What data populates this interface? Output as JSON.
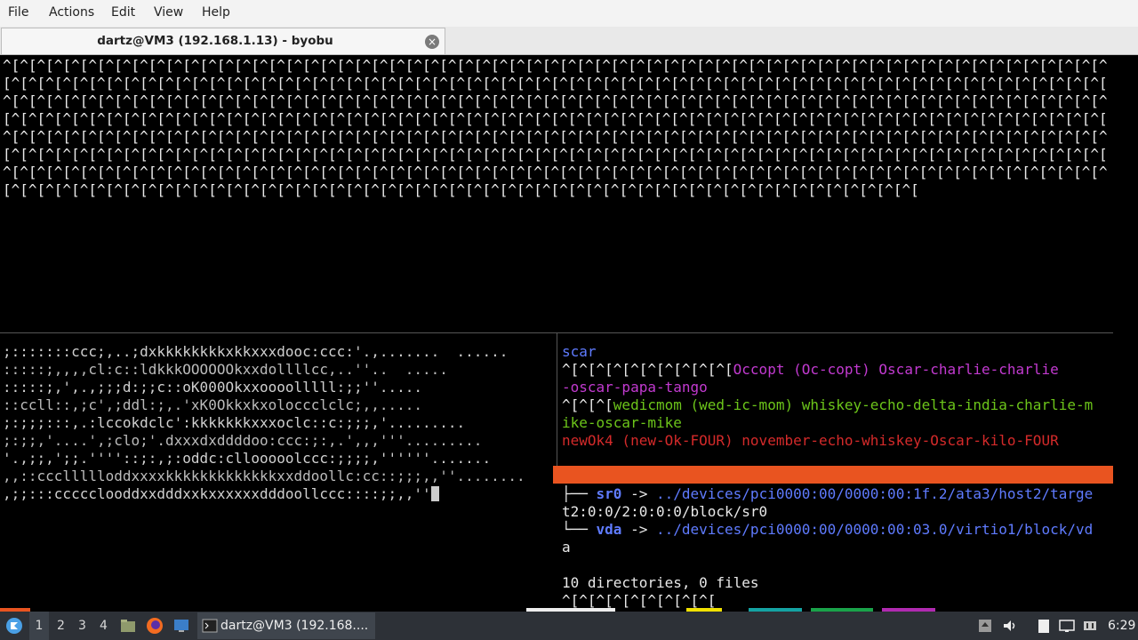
{
  "menu": {
    "file": "File",
    "actions": "Actions",
    "edit": "Edit",
    "view": "View",
    "help": "Help"
  },
  "tab": {
    "title": "dartz@VM3 (192.168.1.13) - byobu",
    "close": "×"
  },
  "terminal": {
    "top_lines": [
      "^[^[^[^[^[^[^[^[^[^[^[^[^[^[^[^[^[^[^[^[^[^[^[^[^[^[^[^[^[^[^[^[^[^[^[^[^[^[^[^[^[^[^[^[^[^[^[^[^[^[^[^[^[^[^[^[^[^[^[^[^[^[^[^[^",
      "[^[^[^[^[^[^[^[^[^[^[^[^[^[^[^[^[^[^[^[^[^[^[^[^[^[^[^[^[^[^[^[^[^[^[^[^[^[^[^[^[^[^[^[^[^[^[^[^[^[^[^[^[^[^[^[^[^[^[^[^[^[^[^[^[",
      "^[^[^[^[^[^[^[^[^[^[^[^[^[^[^[^[^[^[^[^[^[^[^[^[^[^[^[^[^[^[^[^[^[^[^[^[^[^[^[^[^[^[^[^[^[^[^[^[^[^[^[^[^[^[^[^[^[^[^[^[^[^[^[^[^",
      "[^[^[^[^[^[^[^[^[^[^[^[^[^[^[^[^[^[^[^[^[^[^[^[^[^[^[^[^[^[^[^[^[^[^[^[^[^[^[^[^[^[^[^[^[^[^[^[^[^[^[^[^[^[^[^[^[^[^[^[^[^[^[^[^[",
      "^[^[^[^[^[^[^[^[^[^[^[^[^[^[^[^[^[^[^[^[^[^[^[^[^[^[^[^[^[^[^[^[^[^[^[^[^[^[^[^[^[^[^[^[^[^[^[^[^[^[^[^[^[^[^[^[^[^[^[^[^[^[^[^[^",
      "[^[^[^[^[^[^[^[^[^[^[^[^[^[^[^[^[^[^[^[^[^[^[^[^[^[^[^[^[^[^[^[^[^[^[^[^[^[^[^[^[^[^[^[^[^[^[^[^[^[^[^[^[^[^[^[^[^[^[^[^[^[^[^[^[",
      "^[^[^[^[^[^[^[^[^[^[^[^[^[^[^[^[^[^[^[^[^[^[^[^[^[^[^[^[^[^[^[^[^[^[^[^[^[^[^[^[^[^[^[^[^[^[^[^[^[^[^[^[^[^[^[^[^[^[^[^[^[^[^[^[^",
      "[^[^[^[^[^[^[^[^[^[^[^[^[^[^[^[^[^[^[^[^[^[^[^[^[^[^[^[^[^[^[^[^[^[^[^[^[^[^[^[^[^[^[^[^[^[^[^[^[^[^[^[^[^["
    ],
    "ascii_art": [
      ";:::::::ccc;,..;dxkkkkkkkkxkkxxxdooc:ccc:'.,.......  ......",
      ":::::;,,,,cl:c::ldkkkOOOOOOkxxdollllcc,..''..  .....",
      ":::::;,',.,;;;d:;;c::oK000Okxxoooolllll:;;''.....",
      "::ccll::,;c',;ddl:;,.'xK0Okkxkxoloccclclc;,,.....",
      ";:;;;:::,.:lccokdclc':kkkkkkkxxxoclc::c:;;;,'.........",
      ";:;;,'....',;clo;'.dxxxdxddddoo:ccc:;:,.',,,'''.........",
      "'.,;;,';;.''''::;:,;:oddc:cllooooolccc:;;;;,''''''.......",
      ",,::cccllllloddxxxxkkkkkkkkkkkkkxxddoollc:cc::;;;,,''........",
      ",;;:::ccccclooddxxdddxxkxxxxxxdddoollccc::::;;,,''"
    ],
    "right_pane": {
      "line1": "scar",
      "line2_prefix": "^[^[^[^[^[^[^[^[^[^[",
      "line2_text": "Occopt (Oc-copt) Oscar-charlie-charlie",
      "line3": "-oscar-papa-tango",
      "line4_prefix": "^[^[^[",
      "line4_text": "wedicmom (wed-ic-mom) whiskey-echo-delta-india-charlie-m",
      "line5": "ike-oscar-mike",
      "line6": "newOk4 (new-Ok-FOUR) november-echo-whiskey-Oscar-kilo-FOUR"
    },
    "tree": {
      "branch1": "├── ",
      "name1": "sr0",
      "arrow1": " -> ",
      "path1a": "../devices/pci0000:00/0000:00:1f.2/ata3/host2/targe",
      "path1b": "t2:0:0/2:0:0:0/block/sr0",
      "branch2": "└── ",
      "name2": "vda",
      "arrow2": " -> ",
      "path2a": "../devices/pci0000:00/0000:00:03.0/virtio1/block/vd",
      "path2b": "a",
      "summary": "10 directories, 0 files",
      "last": "^[^[^[^[^[^[^[^[^["
    }
  },
  "taskbar": {
    "workspaces": [
      "1",
      "2",
      "3",
      "4"
    ],
    "task_label": "dartz@VM3 (192.168....",
    "clock": "6:29"
  }
}
